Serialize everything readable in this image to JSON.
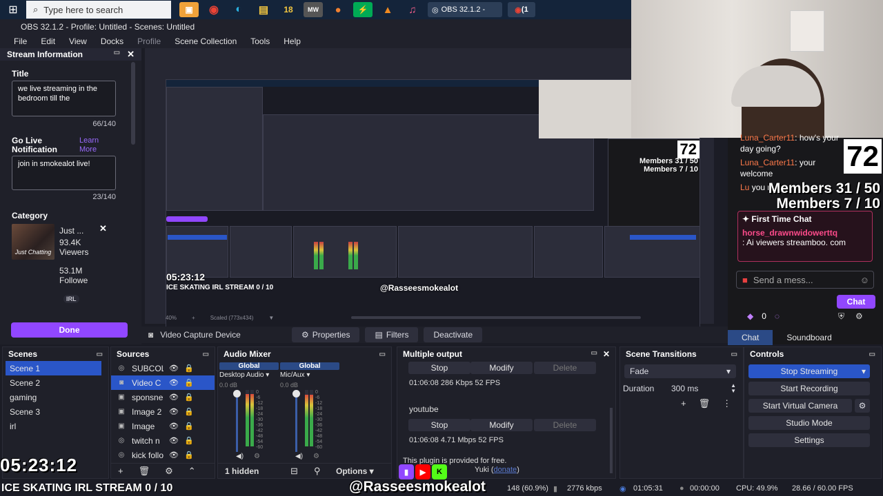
{
  "taskbar": {
    "search_placeholder": "Type here to search",
    "apps": [
      "chrome",
      "edge",
      "explorer",
      "18",
      "MW",
      "app",
      "app",
      "vlc",
      "itunes"
    ],
    "app_18": "18",
    "app_mw": "MW",
    "obs_label": "OBS 32.1.2 -",
    "chrome2_label": "(1"
  },
  "window": {
    "title": "OBS 32.1.2 - Profile: Untitled - Scenes: Untitled"
  },
  "menu": [
    "File",
    "Edit",
    "View",
    "Docks",
    "Profile",
    "Scene Collection",
    "Tools",
    "Help"
  ],
  "stream_info": {
    "header": "Stream Information",
    "title_label": "Title",
    "title_value": "we live streaming in the bedroom till the",
    "title_count": "66/140",
    "golive_label": "Go Live Notification",
    "learn_more": "Learn More",
    "golive_value": "join in smokealot live!",
    "golive_count": "23/140",
    "category_label": "Category",
    "category_img_text": "Just Chatting",
    "category_name": "Just ...",
    "viewers_value": "93.4K",
    "viewers_label": "Viewers",
    "followers_value": "53.1M",
    "followers_label": "Followe",
    "tag": "IRL",
    "done": "Done"
  },
  "preview": {
    "clock": "05:23:12",
    "stream_title": "ICE SKATING IRL STREAM 0 / 10",
    "handle": "@Rasseesmokealot",
    "big_number": "72",
    "members1": "Members 31 / 50",
    "members2": "Members 7 / 10",
    "scale_text": "40%",
    "scale_label": "Scaled (773x434)"
  },
  "source_toolbar": {
    "source_name": "Video Capture Device",
    "properties": "Properties",
    "filters": "Filters",
    "deactivate": "Deactivate"
  },
  "chat": {
    "msg1_user": "Luna_Carter11",
    "msg1_text": "how's your day going?",
    "msg2_user": "Luna_Carter11",
    "msg2_text": "your welcome",
    "msg3_user": "Lu",
    "msg3_text": "you m...",
    "big_number": "72",
    "members1": "Members 31 / 50",
    "members2": "Members 7 / 10",
    "ftc_title": "First Time Chat",
    "ftc_user": "horse_drawnwidowerttq",
    "ftc_text": ": Ai viewers streamboo. com",
    "input_placeholder": "Send a mess...",
    "chat_button": "Chat",
    "points": "0",
    "tabs": [
      "Chat",
      "Soundboard"
    ]
  },
  "docks": {
    "scenes": {
      "title": "Scenes",
      "items": [
        "Scene 1",
        "Scene 2",
        "gaming",
        "Scene 3",
        "irl"
      ]
    },
    "sources": {
      "title": "Sources",
      "items": [
        "SUBCOL",
        "Video C",
        "sponsne",
        "Image 2",
        "Image",
        "twitch n",
        "kick follo"
      ]
    },
    "mixer": {
      "title": "Audio Mixer",
      "ch1_label": "Global",
      "ch1_name": "Desktop Audio",
      "ch1_db": "0.0 dB",
      "ch2_label": "Global",
      "ch2_name": "Mic/Aux",
      "ch2_db": "0.0 dB",
      "ticks": [
        "0",
        "-6",
        "-12",
        "-18",
        "-24",
        "-30",
        "-36",
        "-42",
        "-48",
        "-54",
        "-60"
      ],
      "hidden": "1 hidden",
      "options": "Options"
    },
    "output": {
      "title": "Multiple output",
      "stop": "Stop",
      "modify": "Modify",
      "delete": "Delete",
      "line1": "01:06:08  286 Kbps  52 FPS",
      "name2": "youtube",
      "line2": "01:06:08  4.71 Mbps  52 FPS",
      "plugin_note": "This plugin is provided for free.",
      "credit": "Yuki",
      "donate": "donate"
    },
    "transitions": {
      "title": "Scene Transitions",
      "type": "Fade",
      "duration_label": "Duration",
      "duration_value": "300 ms"
    },
    "controls": {
      "title": "Controls",
      "buttons": [
        "Stop Streaming",
        "Start Recording",
        "Start Virtual Camera",
        "Studio Mode",
        "Settings"
      ]
    }
  },
  "statusbar": {
    "dropped": "148 (60.9%)",
    "bitrate": "2776 kbps",
    "stream_time": "01:05:31",
    "rec_time": "00:00:00",
    "cpu": "CPU: 49.9%",
    "fps": "28.66 / 60.00 FPS"
  },
  "overlay": {
    "clock": "05:23:12",
    "title": "ICE SKATING IRL STREAM 0 / 10",
    "handle": "@Rasseesmokealot"
  },
  "colors": {
    "accent_purple": "#9147ff",
    "selection_blue": "#2a56c8",
    "panel_bg": "#1f2029"
  }
}
